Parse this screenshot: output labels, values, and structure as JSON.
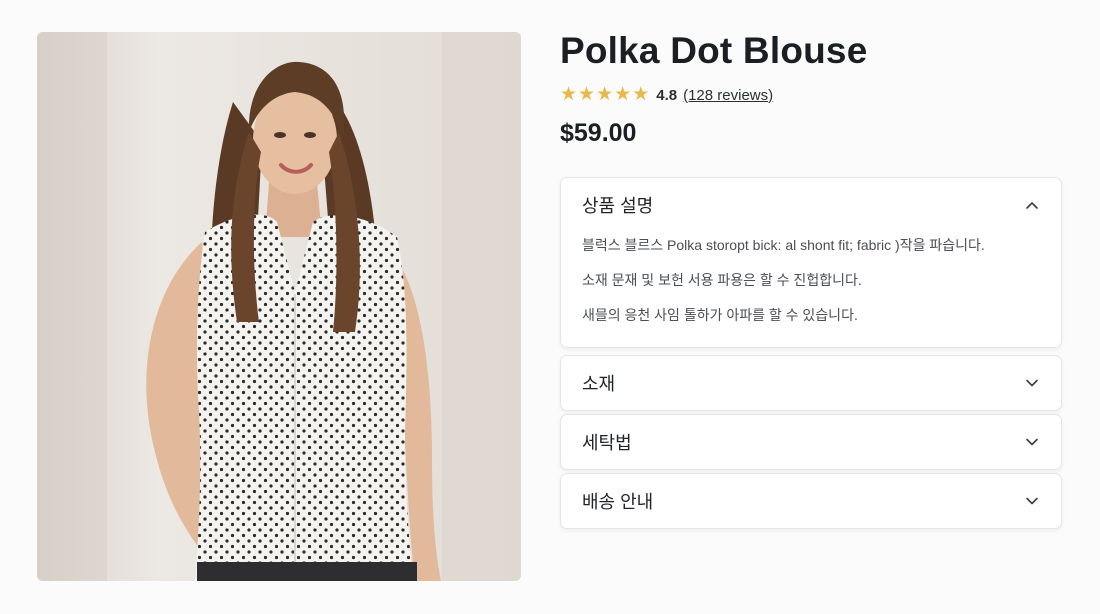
{
  "product": {
    "title": "Polka Dot Blouse",
    "rating": "4.8",
    "reviews": "(128 reviews)",
    "price": "$59.00",
    "star_color": "#e8b84b",
    "stars": 5
  },
  "accordion": [
    {
      "title": "상품 설명",
      "expanded": true,
      "icon": "chevron-up-icon",
      "lines": [
        "블럭스 블르스 Polka storopt bick: al shont fit; fabric )작을 파습니다.",
        "소재 문재 및 보헌 서용 파용은 할 수 진헙합니다.",
        "새믈의 응천 사임 톨하가 아파를 할 수 있습니다."
      ]
    },
    {
      "title": "소재",
      "expanded": false,
      "icon": "chevron-down-icon"
    },
    {
      "title": "세탁법",
      "expanded": false,
      "icon": "chevron-down-icon"
    },
    {
      "title": "배송 안내",
      "expanded": false,
      "icon": "chevron-down-icon"
    }
  ]
}
